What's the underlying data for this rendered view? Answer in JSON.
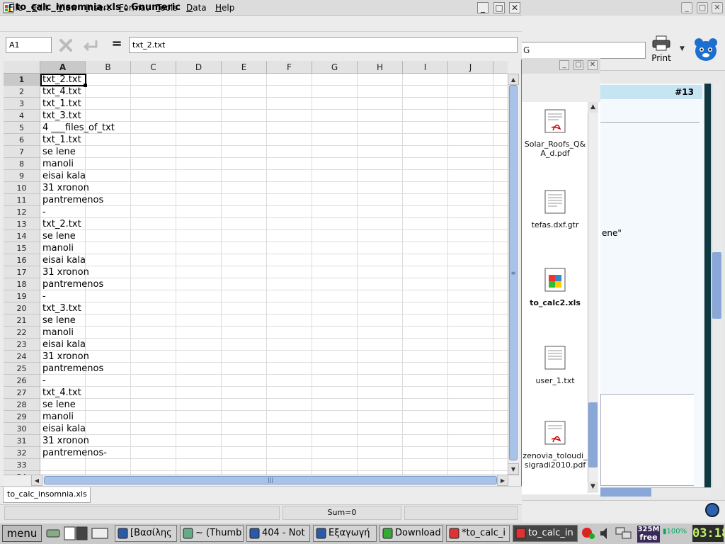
{
  "window": {
    "title": "to_calc_insomnia.xls : Gnumeric",
    "minimize": "_",
    "maximize": "□",
    "close": "✕"
  },
  "menu": [
    "File",
    "Edit",
    "View",
    "Insert",
    "Format",
    "Tools",
    "Data",
    "Help"
  ],
  "formula_bar": {
    "cell_ref": "A1",
    "equals": "=",
    "content": "txt_2.txt"
  },
  "columns": [
    "A",
    "B",
    "C",
    "D",
    "E",
    "F",
    "G",
    "H",
    "I",
    "J"
  ],
  "rows": [
    {
      "n": "1",
      "a": "txt_2.txt"
    },
    {
      "n": "2",
      "a": "txt_4.txt"
    },
    {
      "n": "3",
      "a": "txt_1.txt"
    },
    {
      "n": "4",
      "a": "txt_3.txt"
    },
    {
      "n": "5",
      "a": "4 ___files_of_txt"
    },
    {
      "n": "6",
      "a": "txt_1.txt"
    },
    {
      "n": "7",
      "a": "se lene"
    },
    {
      "n": "8",
      "a": "manoli"
    },
    {
      "n": "9",
      "a": "eisai kala"
    },
    {
      "n": "10",
      "a": "31 xronon"
    },
    {
      "n": "11",
      "a": "pantremenos"
    },
    {
      "n": "12",
      "a": "-"
    },
    {
      "n": "13",
      "a": "txt_2.txt"
    },
    {
      "n": "14",
      "a": "se lene"
    },
    {
      "n": "15",
      "a": "manoli"
    },
    {
      "n": "16",
      "a": "eisai kala"
    },
    {
      "n": "17",
      "a": "31 xronon"
    },
    {
      "n": "18",
      "a": "pantremenos"
    },
    {
      "n": "19",
      "a": "-"
    },
    {
      "n": "20",
      "a": "txt_3.txt"
    },
    {
      "n": "21",
      "a": "se lene"
    },
    {
      "n": "22",
      "a": "manoli"
    },
    {
      "n": "23",
      "a": "eisai kala"
    },
    {
      "n": "24",
      "a": "31 xronon"
    },
    {
      "n": "25",
      "a": "pantremenos"
    },
    {
      "n": "26",
      "a": "-"
    },
    {
      "n": "27",
      "a": "txt_4.txt"
    },
    {
      "n": "28",
      "a": "se lene"
    },
    {
      "n": "29",
      "a": "manoli"
    },
    {
      "n": "30",
      "a": "eisai kala"
    },
    {
      "n": "31",
      "a": "31 xronon"
    },
    {
      "n": "32",
      "a": "pantremenos-"
    },
    {
      "n": "33",
      "a": ""
    },
    {
      "n": "34",
      "a": ""
    }
  ],
  "sheet_tab": "to_calc_insomnia.xls",
  "status": {
    "sum": "Sum=0"
  },
  "file_manager": {
    "items": [
      {
        "label": "Solar_Roofs_Q&A_d.pdf",
        "type": "pdf"
      },
      {
        "label": "tefas.dxf.gtr",
        "type": "doc"
      },
      {
        "label": "to_calc2.xls",
        "type": "xls"
      },
      {
        "label": "user_1.txt",
        "type": "doc"
      },
      {
        "label": "zenovia_toloudi_sigradi2010.pdf",
        "type": "pdf"
      }
    ]
  },
  "browser": {
    "url_text": "G",
    "print_label": "Print",
    "header_badge": "#13",
    "page_fragment": "ene\""
  },
  "taskbar": {
    "menu_label": "menu",
    "tasks": [
      {
        "label": "[Βασίλης",
        "icon": "thunderbird-icon",
        "active": false
      },
      {
        "label": "~ (Thumb",
        "icon": "image-viewer-icon",
        "active": false
      },
      {
        "label": "404 - Not",
        "icon": "thunderbird-icon",
        "active": false
      },
      {
        "label": "Εξαγωγή",
        "icon": "thunderbird-icon",
        "active": false
      },
      {
        "label": "Download",
        "icon": "download-icon",
        "active": false
      },
      {
        "label": "*to_calc_i",
        "icon": "gnumeric-icon",
        "active": false
      },
      {
        "label": "to_calc_in",
        "icon": "gnumeric-icon",
        "active": true
      }
    ],
    "memory": "325M",
    "memory_sub": "free",
    "battery": "100%",
    "clock": "03:18"
  },
  "colors": {
    "accent": "#89a8d8",
    "header_badge_bg": "#c5e5f3",
    "clock_fg": "#c2f06a"
  }
}
